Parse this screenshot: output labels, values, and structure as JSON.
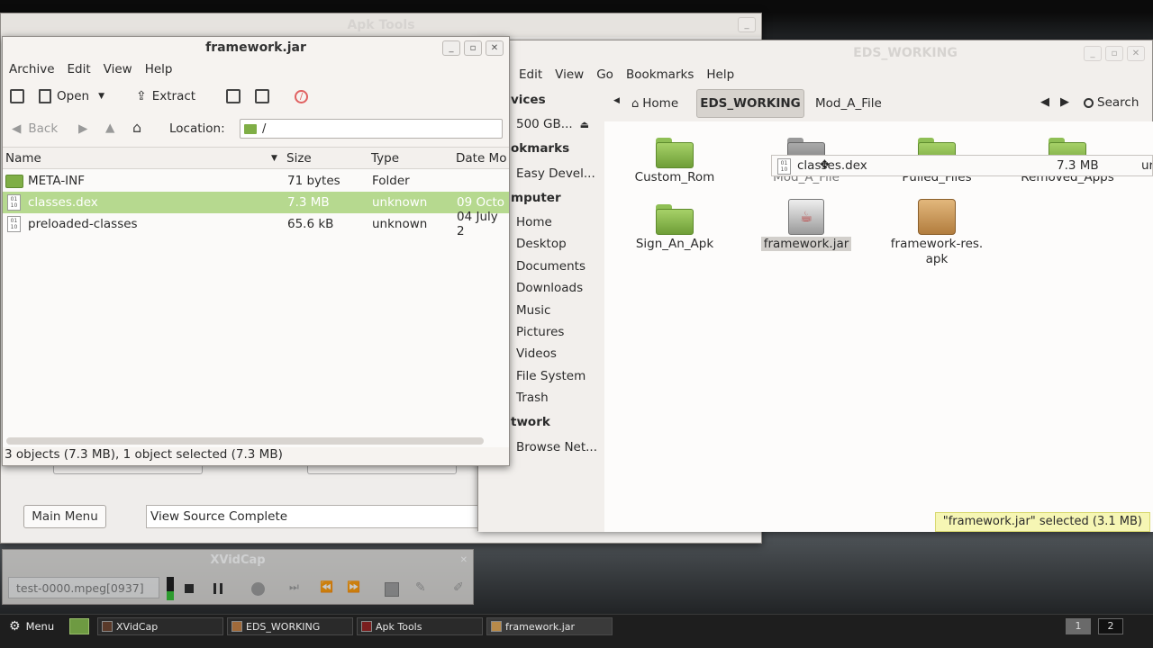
{
  "apk_tools": {
    "title": "Apk Tools",
    "main_menu_label": "Main Menu",
    "status_text": "View Source Complete"
  },
  "xvidcap": {
    "title": "XVidCap",
    "filename": "test-0000.mpeg[0937]"
  },
  "archive": {
    "title": "framework.jar",
    "menu": [
      "Archive",
      "Edit",
      "View",
      "Help"
    ],
    "toolbar": {
      "open_label": "Open",
      "extract_label": "Extract"
    },
    "nav": {
      "back_label": "Back",
      "location_label": "Location:",
      "location_value": "/"
    },
    "columns": [
      "Name",
      "Size",
      "Type",
      "Date Mo"
    ],
    "rows": [
      {
        "name": "META-INF",
        "size": "71 bytes",
        "type": "Folder",
        "date": ""
      },
      {
        "name": "classes.dex",
        "size": "7.3 MB",
        "type": "unknown",
        "date": "09 Octo"
      },
      {
        "name": "preloaded-classes",
        "size": "65.6 kB",
        "type": "unknown",
        "date": "04 July 2"
      }
    ],
    "status": "3 objects (7.3 MB), 1 object selected (7.3 MB)"
  },
  "files": {
    "title": "EDS_WORKING",
    "menu": [
      "Edit",
      "View",
      "Go",
      "Bookmarks",
      "Help"
    ],
    "path": {
      "home": "Home",
      "current": "EDS_WORKING",
      "next": "Mod_A_File"
    },
    "search_label": "Search",
    "sidebar": {
      "devices_header": "vices",
      "device_item": "500 GB...",
      "bookmarks_header": "okmarks",
      "bookmark_item": "Easy Devel...",
      "computer_header": "mputer",
      "computer_items": [
        "Home",
        "Desktop",
        "Documents",
        "Downloads",
        "Music",
        "Pictures",
        "Videos",
        "File System",
        "Trash"
      ],
      "network_header": "twork",
      "network_item": "Browse Net..."
    },
    "items": [
      {
        "label": "Custom_Rom",
        "kind": "folder"
      },
      {
        "label": "Mod_A_File",
        "kind": "folder"
      },
      {
        "label": "Pulled_Files",
        "kind": "folder"
      },
      {
        "label": "Removed_Apps",
        "kind": "folder"
      },
      {
        "label": "Sign_An_Apk",
        "kind": "folder"
      },
      {
        "label": "framework.jar",
        "kind": "jar"
      },
      {
        "label": "framework-res.\napk",
        "kind": "package"
      }
    ],
    "status": "\"framework.jar\" selected (3.1 MB)"
  },
  "drag": {
    "name": "classes.dex",
    "size": "7.3 MB",
    "type_partial": "ur"
  },
  "taskbar": {
    "menu_label": "Menu",
    "tasks": [
      "XVidCap",
      "EDS_WORKING",
      "Apk Tools",
      "framework.jar"
    ],
    "workspaces": [
      "1",
      "2"
    ]
  }
}
